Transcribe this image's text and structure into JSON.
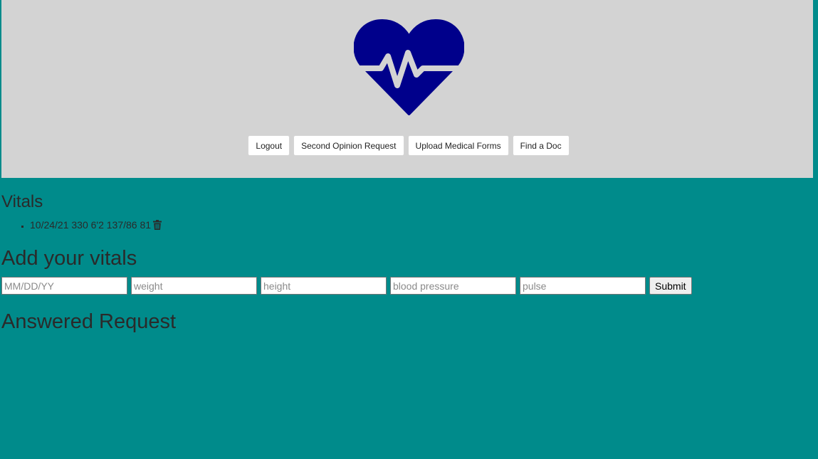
{
  "header": {
    "logo_icon": "heart-pulse-icon",
    "logo_color": "#00008b",
    "background": "#d3d3d3",
    "nav_buttons": [
      {
        "label": "Logout"
      },
      {
        "label": "Second Opinion Request"
      },
      {
        "label": "Upload Medical Forms"
      },
      {
        "label": "Find a Doc"
      }
    ]
  },
  "vitals": {
    "title": "Vitals",
    "entries": [
      {
        "text": "10/24/21 330 6'2 137/86 81",
        "delete_icon": "trash-icon"
      }
    ]
  },
  "add_vitals": {
    "title": "Add your vitals",
    "fields": [
      {
        "placeholder": "MM/DD/YY",
        "value": ""
      },
      {
        "placeholder": "weight",
        "value": ""
      },
      {
        "placeholder": "height",
        "value": ""
      },
      {
        "placeholder": "blood pressure",
        "value": ""
      },
      {
        "placeholder": "pulse",
        "value": ""
      }
    ],
    "submit_label": "Submit"
  },
  "answered": {
    "title": "Answered Request"
  },
  "colors": {
    "page_background": "#008b8b",
    "text": "#2a2a2a"
  }
}
